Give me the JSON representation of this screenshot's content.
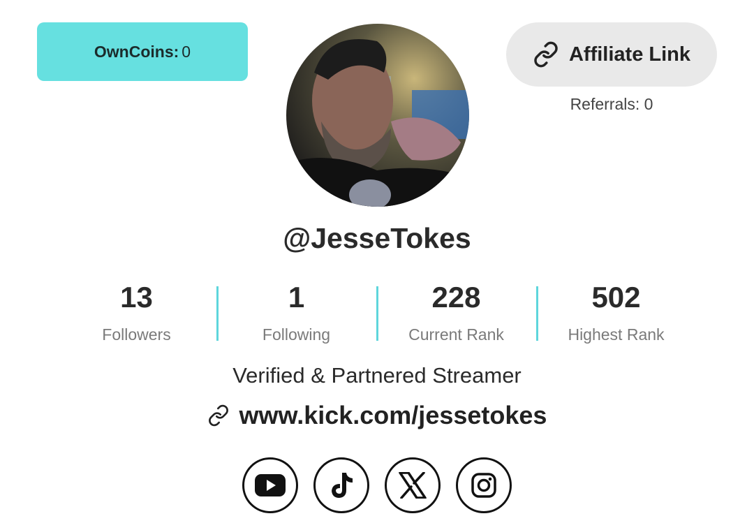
{
  "coins": {
    "label": "OwnCoins:",
    "value": "0"
  },
  "affiliate": {
    "label": "Affiliate Link",
    "icon": "link-icon"
  },
  "referrals": {
    "text": "Referrals: 0"
  },
  "profile": {
    "username": "@JesseTokes",
    "bio": "Verified & Partnered Streamer",
    "link": "www.kick.com/jessetokes"
  },
  "stats": [
    {
      "value": "13",
      "label": "Followers"
    },
    {
      "value": "1",
      "label": "Following"
    },
    {
      "value": "228",
      "label": "Current Rank"
    },
    {
      "value": "502",
      "label": "Highest Rank"
    }
  ],
  "socials": [
    {
      "name": "youtube-icon"
    },
    {
      "name": "tiktok-icon"
    },
    {
      "name": "x-icon"
    },
    {
      "name": "instagram-icon"
    }
  ],
  "colors": {
    "accent": "#66e0e0",
    "divider": "#5ed6dc",
    "button_gray": "#e9e9e9"
  }
}
